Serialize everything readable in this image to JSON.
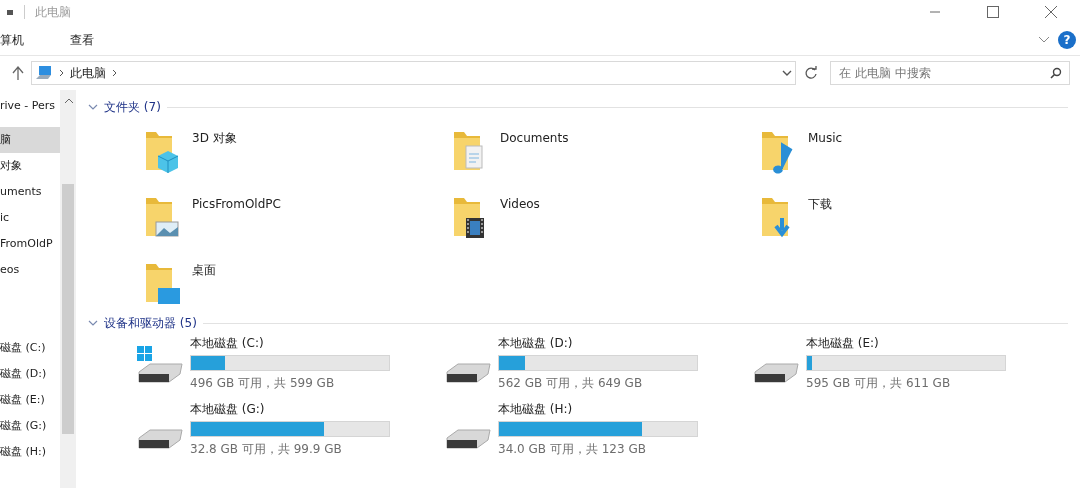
{
  "window": {
    "title": "此电脑"
  },
  "ribbon": {
    "tabs": [
      {
        "label": "算机",
        "selected": false
      },
      {
        "label": "查看",
        "selected": false
      }
    ]
  },
  "address": {
    "path": [
      "此电脑"
    ]
  },
  "search": {
    "placeholder": "在 此电脑 中搜索"
  },
  "help": {
    "label": "?"
  },
  "sidebar": {
    "sections": [
      [
        {
          "label": "rive - Pers",
          "selected": false
        },
        {
          "label": "脑",
          "selected": true
        },
        {
          "label": "对象",
          "selected": false
        },
        {
          "label": "uments",
          "selected": false
        },
        {
          "label": "ic",
          "selected": false
        },
        {
          "label": "FromOldP",
          "selected": false
        },
        {
          "label": "eos",
          "selected": false
        }
      ],
      [
        {
          "label": "磁盘 (C:)",
          "selected": false
        },
        {
          "label": "磁盘 (D:)",
          "selected": false
        },
        {
          "label": "磁盘 (E:)",
          "selected": false
        },
        {
          "label": "磁盘 (G:)",
          "selected": false
        },
        {
          "label": "磁盘 (H:)",
          "selected": false
        }
      ]
    ]
  },
  "folders": {
    "title": "文件夹 (7)",
    "expanded": true,
    "items": [
      {
        "name": "3D 对象",
        "kind": "cube"
      },
      {
        "name": "Documents",
        "kind": "document"
      },
      {
        "name": "Music",
        "kind": "music"
      },
      {
        "name": "PicsFromOldPC",
        "kind": "picture"
      },
      {
        "name": "Videos",
        "kind": "video"
      },
      {
        "name": "下载",
        "kind": "download"
      },
      {
        "name": "桌面",
        "kind": "desktop"
      }
    ]
  },
  "drives": {
    "title": "设备和驱动器 (5)",
    "expanded": true,
    "items": [
      {
        "name": "本地磁盘 (C:)",
        "kind": "system",
        "level": 0.17,
        "reading": "496 GB 可用，共 599 GB"
      },
      {
        "name": "本地磁盘 (D:)",
        "kind": "plain",
        "level": 0.13,
        "reading": "562 GB 可用，共 649 GB"
      },
      {
        "name": "本地磁盘 (E:)",
        "kind": "plain",
        "level": 0.026,
        "reading": "595 GB 可用，共 611 GB"
      },
      {
        "name": "本地磁盘 (G:)",
        "kind": "plain",
        "level": 0.67,
        "reading": "32.8 GB 可用，共 99.9 GB"
      },
      {
        "name": "本地磁盘 (H:)",
        "kind": "plain",
        "level": 0.72,
        "reading": "34.0 GB 可用，共 123 GB"
      }
    ]
  }
}
